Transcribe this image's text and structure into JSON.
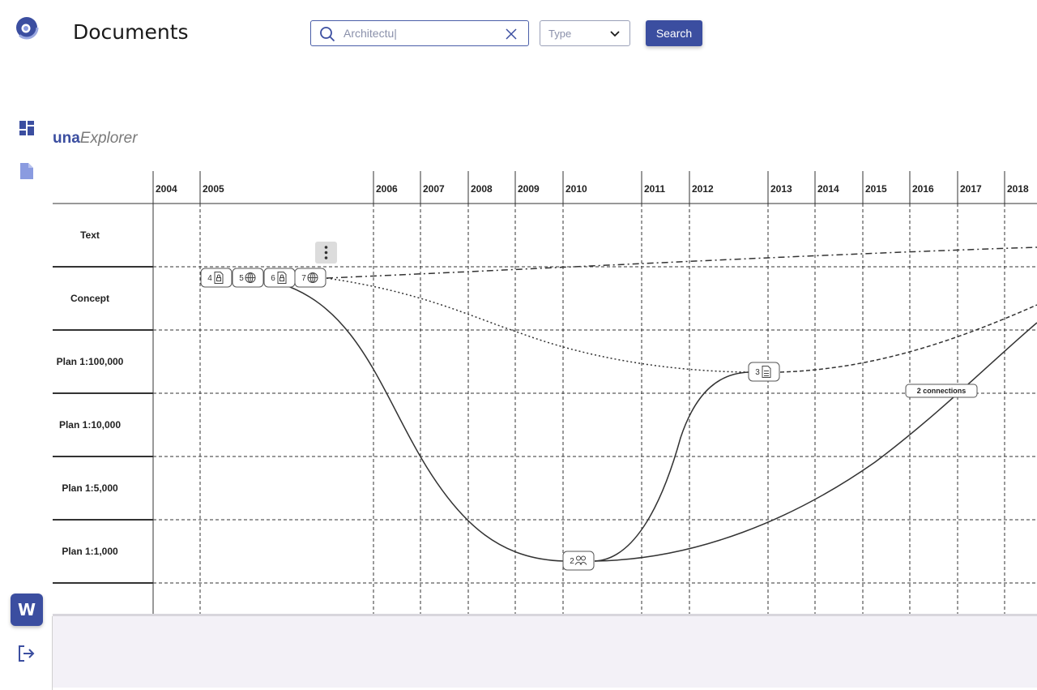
{
  "header": {
    "title": "Documents",
    "search": {
      "value": "Architectu|",
      "icon": "search-icon"
    },
    "type_select": {
      "label": "Type",
      "icon": "chevron-down-icon"
    },
    "search_button": "Search"
  },
  "sidebar": {
    "items": [
      {
        "name": "dashboard",
        "icon": "dashboard-icon"
      },
      {
        "name": "documents",
        "icon": "document-icon"
      }
    ],
    "workspace_badge": "W",
    "logout_icon": "logout-icon"
  },
  "explorer": {
    "brand_bold": "una",
    "brand_italic": "Explorer"
  },
  "timeline": {
    "years": [
      "2004",
      "2005",
      "2006",
      "2007",
      "2008",
      "2009",
      "2010",
      "2011",
      "2012",
      "2013",
      "2014",
      "2015",
      "2016",
      "2017",
      "2018"
    ],
    "rows": [
      "Text",
      "Concept",
      "Plan 1:100,000",
      "Plan 1:10,000",
      "Plan 1:5,000",
      "Plan 1:1,000",
      ""
    ],
    "nodes": [
      {
        "label": "4",
        "icon": "locked-document-icon"
      },
      {
        "label": "5",
        "icon": "globe-icon"
      },
      {
        "label": "6",
        "icon": "locked-document-icon"
      },
      {
        "label": "7",
        "icon": "globe-icon"
      },
      {
        "label": "3",
        "icon": "spreadsheet-icon"
      },
      {
        "label": "2",
        "icon": "people-icon"
      }
    ],
    "connection_label": "2 connections",
    "menu_icon": "kebab-menu-icon"
  },
  "colors": {
    "accent": "#3b4ea0",
    "panel": "#f3f1f7"
  }
}
